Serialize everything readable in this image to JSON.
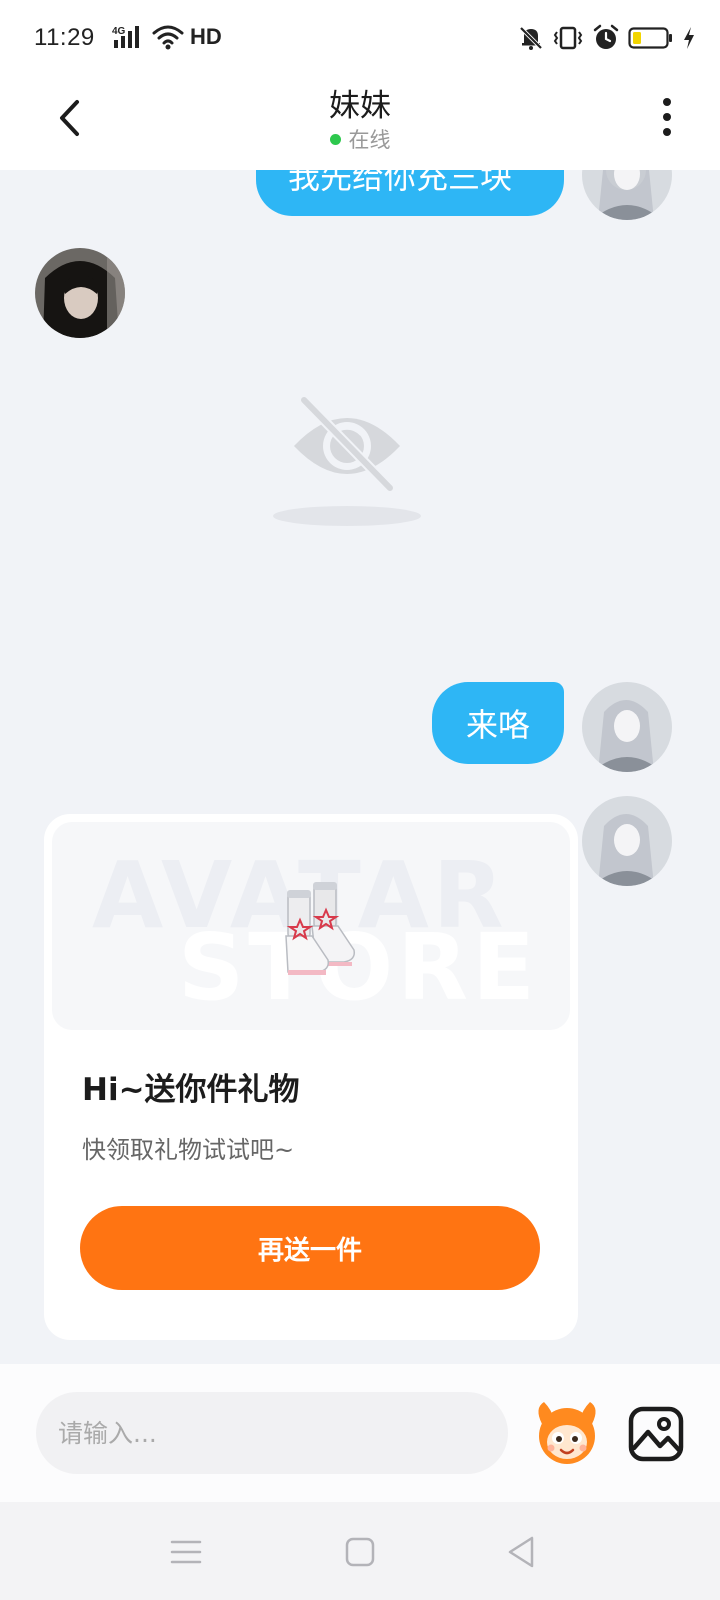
{
  "status_bar": {
    "time": "11:29",
    "network": "4G",
    "hd": "HD",
    "icons": [
      "signal-icon",
      "wifi-icon",
      "mute-icon",
      "vibrate-icon",
      "alarm-icon",
      "battery-icon",
      "charging-icon"
    ]
  },
  "header": {
    "title": "妹妹",
    "status": "在线",
    "status_color": "#2dc84d"
  },
  "messages": [
    {
      "from": "me",
      "type": "text",
      "text": "我先给你充三块"
    },
    {
      "from": "contact",
      "type": "image",
      "status": "unavailable"
    },
    {
      "from": "me",
      "type": "text",
      "text": "来咯"
    },
    {
      "from": "me",
      "type": "gift_card",
      "watermark_line1": "AVATAR",
      "watermark_line2": "STORE",
      "title": "Hi~送你件礼物",
      "subtitle": "快领取礼物试试吧~",
      "button": "再送一件"
    }
  ],
  "composer": {
    "placeholder": "请输入..."
  },
  "colors": {
    "bubble": "#2eb6f5",
    "button": "#ff7412",
    "chat_bg": "#f1f3f7"
  }
}
